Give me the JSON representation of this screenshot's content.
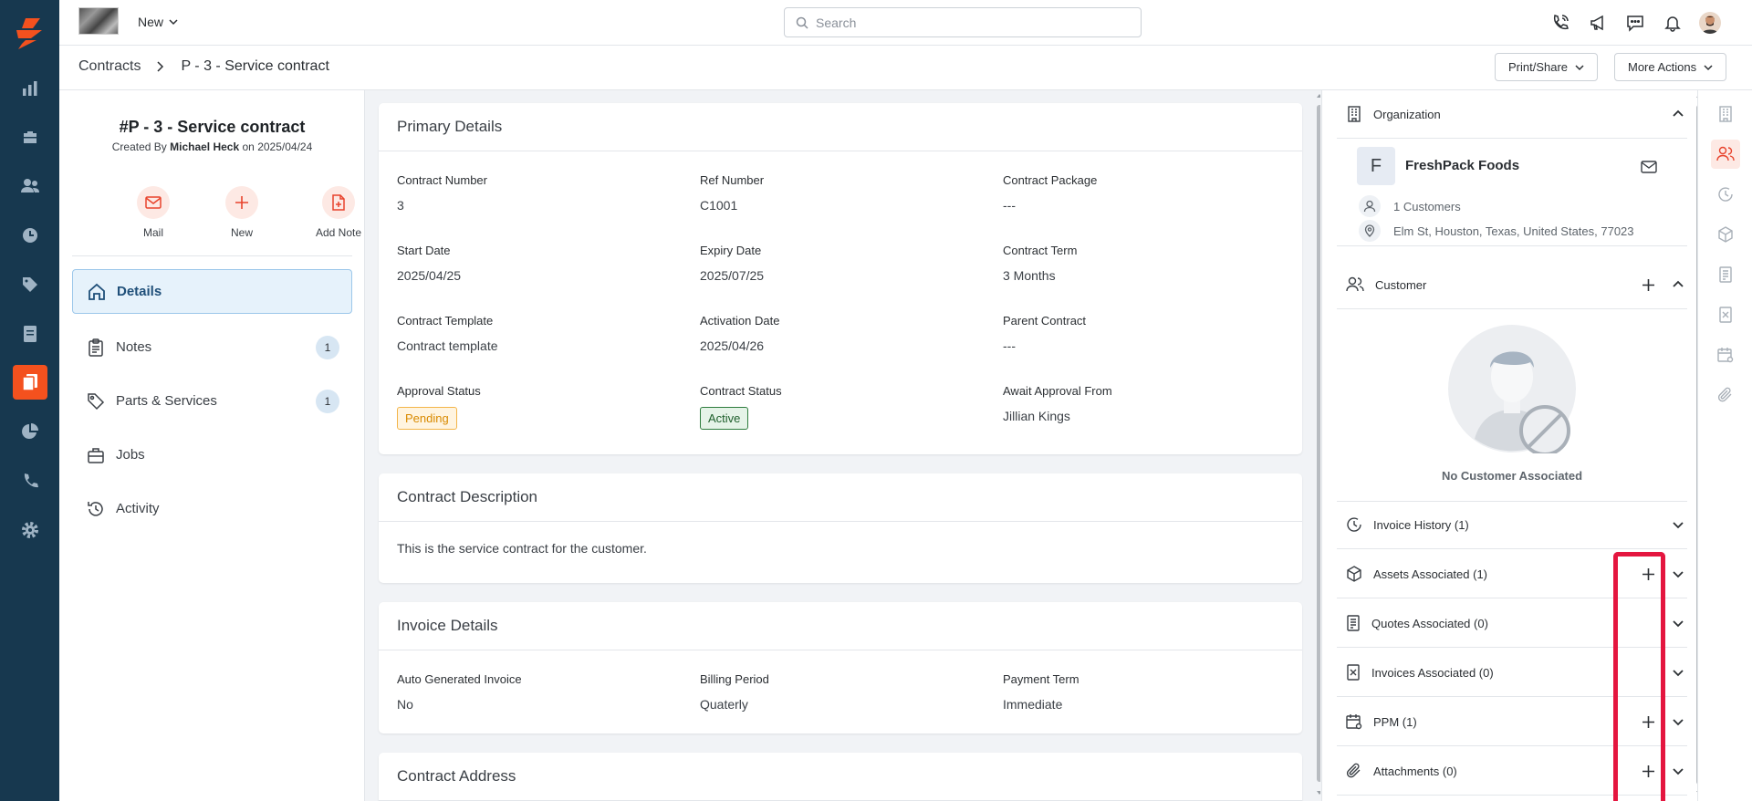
{
  "colors": {
    "rail": "#17384f",
    "accent": "#f4511e",
    "active_blue": "#1f4f79",
    "highlight": "#e4163f"
  },
  "rail": {
    "logo_icon": "zuper-bolt-logo-icon",
    "items": [
      {
        "name": "reports-icon"
      },
      {
        "name": "jobs-icon"
      },
      {
        "name": "users-icon"
      },
      {
        "name": "timesheet-icon"
      },
      {
        "name": "tags-icon"
      },
      {
        "name": "invoices-icon"
      },
      {
        "name": "contracts-icon",
        "active": true
      },
      {
        "name": "analytics-icon"
      },
      {
        "name": "phone-icon"
      },
      {
        "name": "settings-icon"
      }
    ]
  },
  "topbar": {
    "new_label": "New",
    "search_placeholder": "Search",
    "icons": [
      "phone-call-icon",
      "megaphone-icon",
      "chat-icon",
      "bell-icon",
      "user-avatar"
    ]
  },
  "breadcrumb": {
    "root": "Contracts",
    "current": "P - 3 - Service contract",
    "print_share": "Print/Share",
    "more_actions": "More Actions"
  },
  "left": {
    "title": "#P - 3 - Service contract",
    "created_prefix": "Created By",
    "created_by": "Michael Heck",
    "created_on_word": "on",
    "created_date": "2025/04/24",
    "quick_actions": [
      "Mail",
      "New",
      "Add Note"
    ],
    "nav": [
      {
        "label": "Details",
        "icon": "home-icon",
        "active": true
      },
      {
        "label": "Notes",
        "icon": "clipboard-icon",
        "badge": "1"
      },
      {
        "label": "Parts & Services",
        "icon": "tag-icon",
        "badge": "1"
      },
      {
        "label": "Jobs",
        "icon": "briefcase-icon"
      },
      {
        "label": "Activity",
        "icon": "history-icon"
      }
    ]
  },
  "primary": {
    "title": "Primary Details",
    "contract_number_label": "Contract Number",
    "contract_number": "3",
    "ref_number_label": "Ref Number",
    "ref_number": "C1001",
    "contract_package_label": "Contract Package",
    "contract_package": "---",
    "start_date_label": "Start Date",
    "start_date": "2025/04/25",
    "expiry_date_label": "Expiry Date",
    "expiry_date": "2025/07/25",
    "contract_term_label": "Contract Term",
    "contract_term": "3 Months",
    "contract_template_label": "Contract Template",
    "contract_template": "Contract template",
    "activation_date_label": "Activation Date",
    "activation_date": "2025/04/26",
    "parent_contract_label": "Parent Contract",
    "parent_contract": "---",
    "approval_status_label": "Approval Status",
    "approval_status": "Pending",
    "contract_status_label": "Contract Status",
    "contract_status": "Active",
    "await_approval_label": "Await Approval From",
    "await_approval": "Jillian Kings"
  },
  "description": {
    "title": "Contract Description",
    "text": "This is the service contract for the customer."
  },
  "invoice": {
    "title": "Invoice Details",
    "auto_label": "Auto Generated Invoice",
    "auto": "No",
    "billing_label": "Billing Period",
    "billing": "Quaterly",
    "payment_label": "Payment Term",
    "payment": "Immediate"
  },
  "address": {
    "title": "Contract Address"
  },
  "right": {
    "organization_label": "Organization",
    "org_letter": "F",
    "org_name": "FreshPack Foods",
    "customers_count": "1 Customers",
    "org_address": "Elm St, Houston, Texas, United States, 77023",
    "customer_label": "Customer",
    "no_customer": "No Customer Associated",
    "invoice_history": "Invoice History (1)",
    "assets": "Assets Associated (1)",
    "quotes": "Quotes Associated (0)",
    "invoices_assoc": "Invoices Associated (0)",
    "ppm": "PPM (1)",
    "attachments": "Attachments (0)"
  },
  "strip": {
    "items": [
      "building-icon",
      "users-icon",
      "invoice-history-icon",
      "box-icon",
      "quote-icon",
      "invoice-icon",
      "calendar-gear-icon",
      "paperclip-icon"
    ],
    "active_index": 1
  }
}
